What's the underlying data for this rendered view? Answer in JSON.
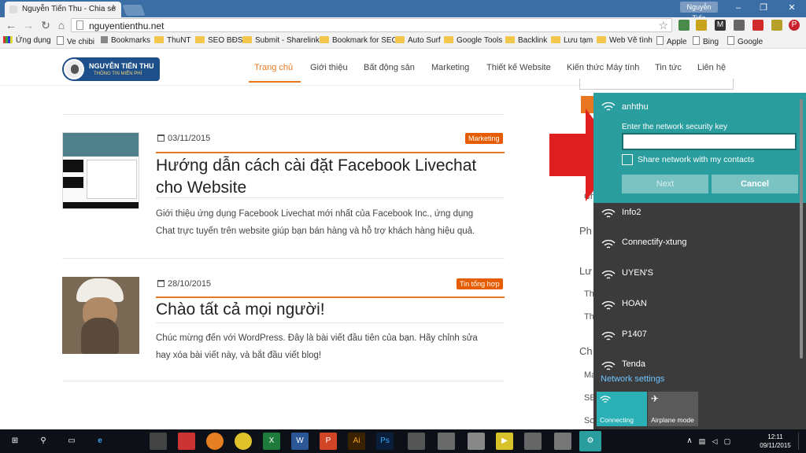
{
  "browser": {
    "tab_title": "Nguyễn Tiến Thu - Chia sẻ",
    "tab_close": "×",
    "user_badge": "Nguyễn Tiến",
    "window_controls": [
      "–",
      "❐",
      "✕"
    ],
    "url": "nguyentienthu.net",
    "nav_icons": [
      "back-icon",
      "forward-icon",
      "reload-icon",
      "home-icon"
    ],
    "bookmarks": [
      {
        "label": "Ứng dụng",
        "icon": "apps-icon"
      },
      {
        "label": "Ve chibi",
        "icon": "page-icon"
      },
      {
        "label": "Bookmarks",
        "icon": "bookmark-icon"
      },
      {
        "label": "ThuNT",
        "icon": "folder-icon"
      },
      {
        "label": "SEO BĐS",
        "icon": "folder-icon"
      },
      {
        "label": "Submit - Sharelink",
        "icon": "folder-icon"
      },
      {
        "label": "Bookmark for SEO",
        "icon": "folder-icon"
      },
      {
        "label": "Auto Surf",
        "icon": "folder-icon"
      },
      {
        "label": "Google Tools",
        "icon": "folder-icon"
      },
      {
        "label": "Backlink",
        "icon": "folder-icon"
      },
      {
        "label": "Lưu tạm",
        "icon": "folder-icon"
      },
      {
        "label": "Web Vẽ tình",
        "icon": "folder-icon"
      },
      {
        "label": "Apple",
        "icon": "page-icon"
      },
      {
        "label": "Bing",
        "icon": "page-icon"
      },
      {
        "label": "Google",
        "icon": "page-icon"
      }
    ]
  },
  "site": {
    "logo_line1": "NGUYỄN TIẾN THU",
    "logo_line2": "THÔNG TIN MIỄN PHÍ",
    "nav": [
      "Trang chủ",
      "Giới thiệu",
      "Bất động sản",
      "Marketing",
      "Thiết kế Website",
      "Kiến thức Máy tính",
      "Tin tức",
      "Liên hệ"
    ],
    "active_nav": "Trang chủ",
    "accent": "#e87722"
  },
  "posts": [
    {
      "date": "03/11/2015",
      "category": "Marketing",
      "title_line1": "Hướng dẫn cách cài đặt Facebook Livechat",
      "title_line2": "cho Website",
      "excerpt_line1": "Giới thiệu ứng dụng Facebook Livechat mới nhất của Facebook Inc., ứng dụng",
      "excerpt_line2": "Chat trực tuyến trên website giúp bạn bán hàng và hỗ trợ khách hàng hiệu quả."
    },
    {
      "date": "28/10/2015",
      "category": "Tin tổng hợp",
      "title_line1": "Chào tất cả mọi người!",
      "excerpt_line1": "Chúc mừng đến với WordPress. Đây là bài viết đầu tiên của bạn. Hãy chỉnh sửa",
      "excerpt_line2": "hay xóa bài viết này, và bắt đầu viết blog!"
    }
  ],
  "sidebar_fragments": [
    "Ch",
    "Ph",
    "Lư",
    "Th",
    "Th",
    "Ch",
    "Ma",
    "SE",
    "So"
  ],
  "network_flyout": {
    "selected_ssid": "anhthu",
    "key_label": "Enter the network security key",
    "key_value": "",
    "share_label": "Share network with my contacts",
    "next_label": "Next",
    "cancel_label": "Cancel",
    "networks": [
      "Info2",
      "Connectify-xtung",
      "UYEN'S",
      "HOAN",
      "P1407",
      "Tenda"
    ],
    "settings_link": "Network settings",
    "quick_actions": [
      {
        "label": "Connecting",
        "icon": "wifi-icon",
        "active": true
      },
      {
        "label": "Airplane mode",
        "icon": "airplane-icon",
        "active": false
      }
    ],
    "colors": {
      "accent": "#2a9d9e",
      "panel": "#3b3b3b",
      "link": "#6fc3ff"
    }
  },
  "annotation": {
    "arrow_color": "#e02020"
  },
  "taskbar": {
    "time": "12:11",
    "date": "09/11/2015",
    "tray_chevron": "∧",
    "apps": [
      "start-icon",
      "search-icon",
      "task-view-icon",
      "edge-icon",
      "store-icon",
      "app-icon",
      "firefox-icon",
      "chrome-icon",
      "excel-icon",
      "word-icon",
      "powerpoint-icon",
      "illustrator-icon",
      "photoshop-icon",
      "app-icon",
      "app-icon",
      "video-icon",
      "app-icon",
      "app-icon",
      "settings-icon"
    ]
  }
}
